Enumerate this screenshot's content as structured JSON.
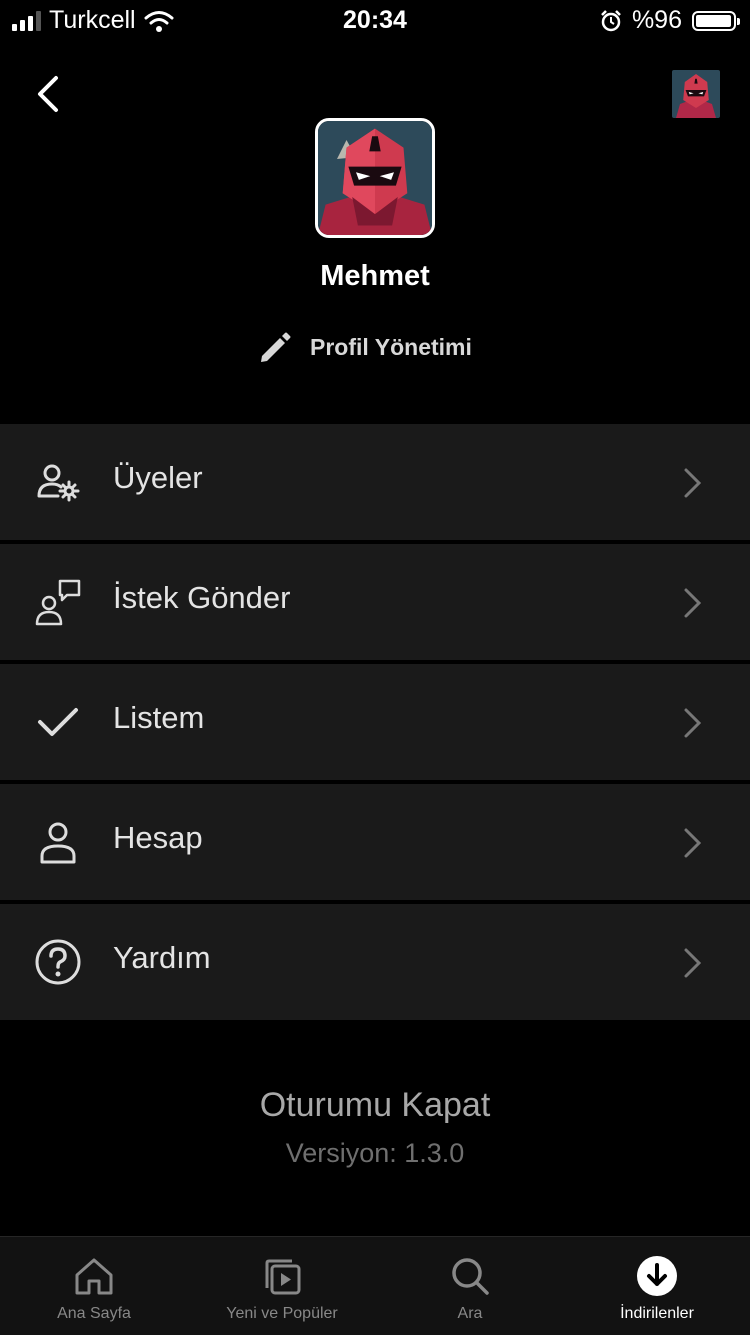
{
  "status_bar": {
    "carrier": "Turkcell",
    "time": "20:34",
    "battery_text": "%96",
    "battery_level": 0.96
  },
  "header": {
    "back_icon": "chevron-left-icon",
    "avatar_icon": "profile-avatar-icon"
  },
  "profile": {
    "name": "Mehmet",
    "manage_label": "Profil Yönetimi",
    "manage_icon": "pencil-icon"
  },
  "menu": {
    "items": [
      {
        "label": "Üyeler",
        "icon": "members-settings-icon"
      },
      {
        "label": "İstek Gönder",
        "icon": "request-chat-icon"
      },
      {
        "label": "Listem",
        "icon": "checkmark-icon"
      },
      {
        "label": "Hesap",
        "icon": "account-icon"
      },
      {
        "label": "Yardım",
        "icon": "help-icon"
      }
    ]
  },
  "footer": {
    "logout_label": "Oturumu Kapat",
    "version_label": "Versiyon: 1.3.0"
  },
  "tabbar": {
    "tabs": [
      {
        "label": "Ana Sayfa",
        "icon": "home-icon",
        "active": false
      },
      {
        "label": "Yeni ve Popüler",
        "icon": "new-popular-icon",
        "active": false
      },
      {
        "label": "Ara",
        "icon": "search-icon",
        "active": false
      },
      {
        "label": "İndirilenler",
        "icon": "download-icon",
        "active": true
      }
    ]
  },
  "colors": {
    "background": "#000000",
    "menu_background": "#1a1a1a",
    "tabbar_background": "#121212",
    "muted_text": "#a8a8a8",
    "avatar_red": "#c8354a"
  }
}
